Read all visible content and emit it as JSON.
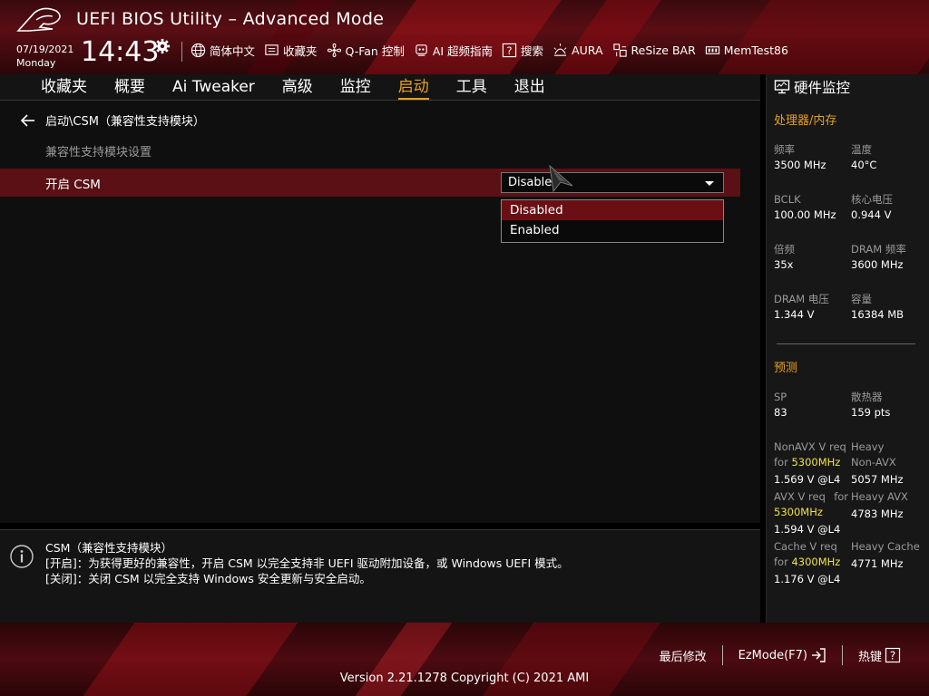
{
  "header": {
    "title": "UEFI BIOS Utility – Advanced Mode",
    "date": "07/19/2021",
    "weekday": "Monday",
    "time": "14:43",
    "toolbar": [
      {
        "icon": "globe-icon",
        "label": "简体中文"
      },
      {
        "icon": "favorites-icon",
        "label": "收藏夹"
      },
      {
        "icon": "fan-icon",
        "label": "Q-Fan 控制"
      },
      {
        "icon": "ai-overclock-icon",
        "label": "AI 超频指南"
      },
      {
        "icon": "search-icon",
        "label": "搜索"
      },
      {
        "icon": "aura-icon",
        "label": "AURA"
      },
      {
        "icon": "resize-bar-icon",
        "label": "ReSize BAR"
      },
      {
        "icon": "memtest-icon",
        "label": "MemTest86"
      }
    ]
  },
  "nav": {
    "tabs": [
      "收藏夹",
      "概要",
      "Ai Tweaker",
      "高级",
      "监控",
      "启动",
      "工具",
      "退出"
    ],
    "active": "启动"
  },
  "main": {
    "breadcrumb": "启动\\CSM（兼容性支持模块）",
    "section_label": "兼容性支持模块设置",
    "setting_label": "开启 CSM",
    "setting_value": "Disabled",
    "options": [
      "Disabled",
      "Enabled"
    ]
  },
  "help": {
    "title": "CSM（兼容性支持模块）",
    "line1": "[开启]：为获得更好的兼容性，开启 CSM 以完全支持非 UEFI 驱动附加设备，或 Windows UEFI 模式。",
    "line2": "[关闭]：关闭 CSM 以完全支持 Windows 安全更新与安全启动。"
  },
  "monitor": {
    "title": "硬件监控",
    "cpu_mem_title": "处理器/内存",
    "cpu_mem": [
      {
        "k": "频率",
        "v": "3500 MHz"
      },
      {
        "k": "温度",
        "v": "40°C"
      },
      {
        "k": "BCLK",
        "v": "100.00 MHz"
      },
      {
        "k": "核心电压",
        "v": "0.944 V"
      },
      {
        "k": "倍频",
        "v": "35x"
      },
      {
        "k": "DRAM 频率",
        "v": "3600 MHz"
      },
      {
        "k": "DRAM 电压",
        "v": "1.344 V"
      },
      {
        "k": "容量",
        "v": "16384 MB"
      }
    ],
    "predict_title": "预测",
    "sp_k": "SP",
    "sp_v": "83",
    "cooler_k": "散热器",
    "cooler_v": "159 pts",
    "nonavx_k1": "NonAVX V req",
    "nonavx_k2": "for",
    "nonavx_freq": "5300MHz",
    "nonavx_v": "1.569 V @L4",
    "heavy_nonavx_k1": "Heavy",
    "heavy_nonavx_k2": "Non-AVX",
    "heavy_nonavx_v": "5057 MHz",
    "avx_k1": "AVX V req",
    "avx_k2": "for",
    "avx_freq": "5300MHz",
    "avx_v": "1.594 V @L4",
    "heavy_avx_k": "Heavy AVX",
    "heavy_avx_v": "4783 MHz",
    "cache_k1": "Cache V req",
    "cache_k2": "for",
    "cache_freq": "4300MHz",
    "cache_v": "1.176 V @L4",
    "heavy_cache_k": "Heavy Cache",
    "heavy_cache_v": "4771 MHz",
    "accent_color": "#e8a21b",
    "highlight_color": "#f2e23b"
  },
  "footer": {
    "last_modified": "最后修改",
    "ezmode": "EzMode(F7)",
    "hotkeys": "热键",
    "version": "Version 2.21.1278 Copyright (C) 2021 AMI"
  }
}
